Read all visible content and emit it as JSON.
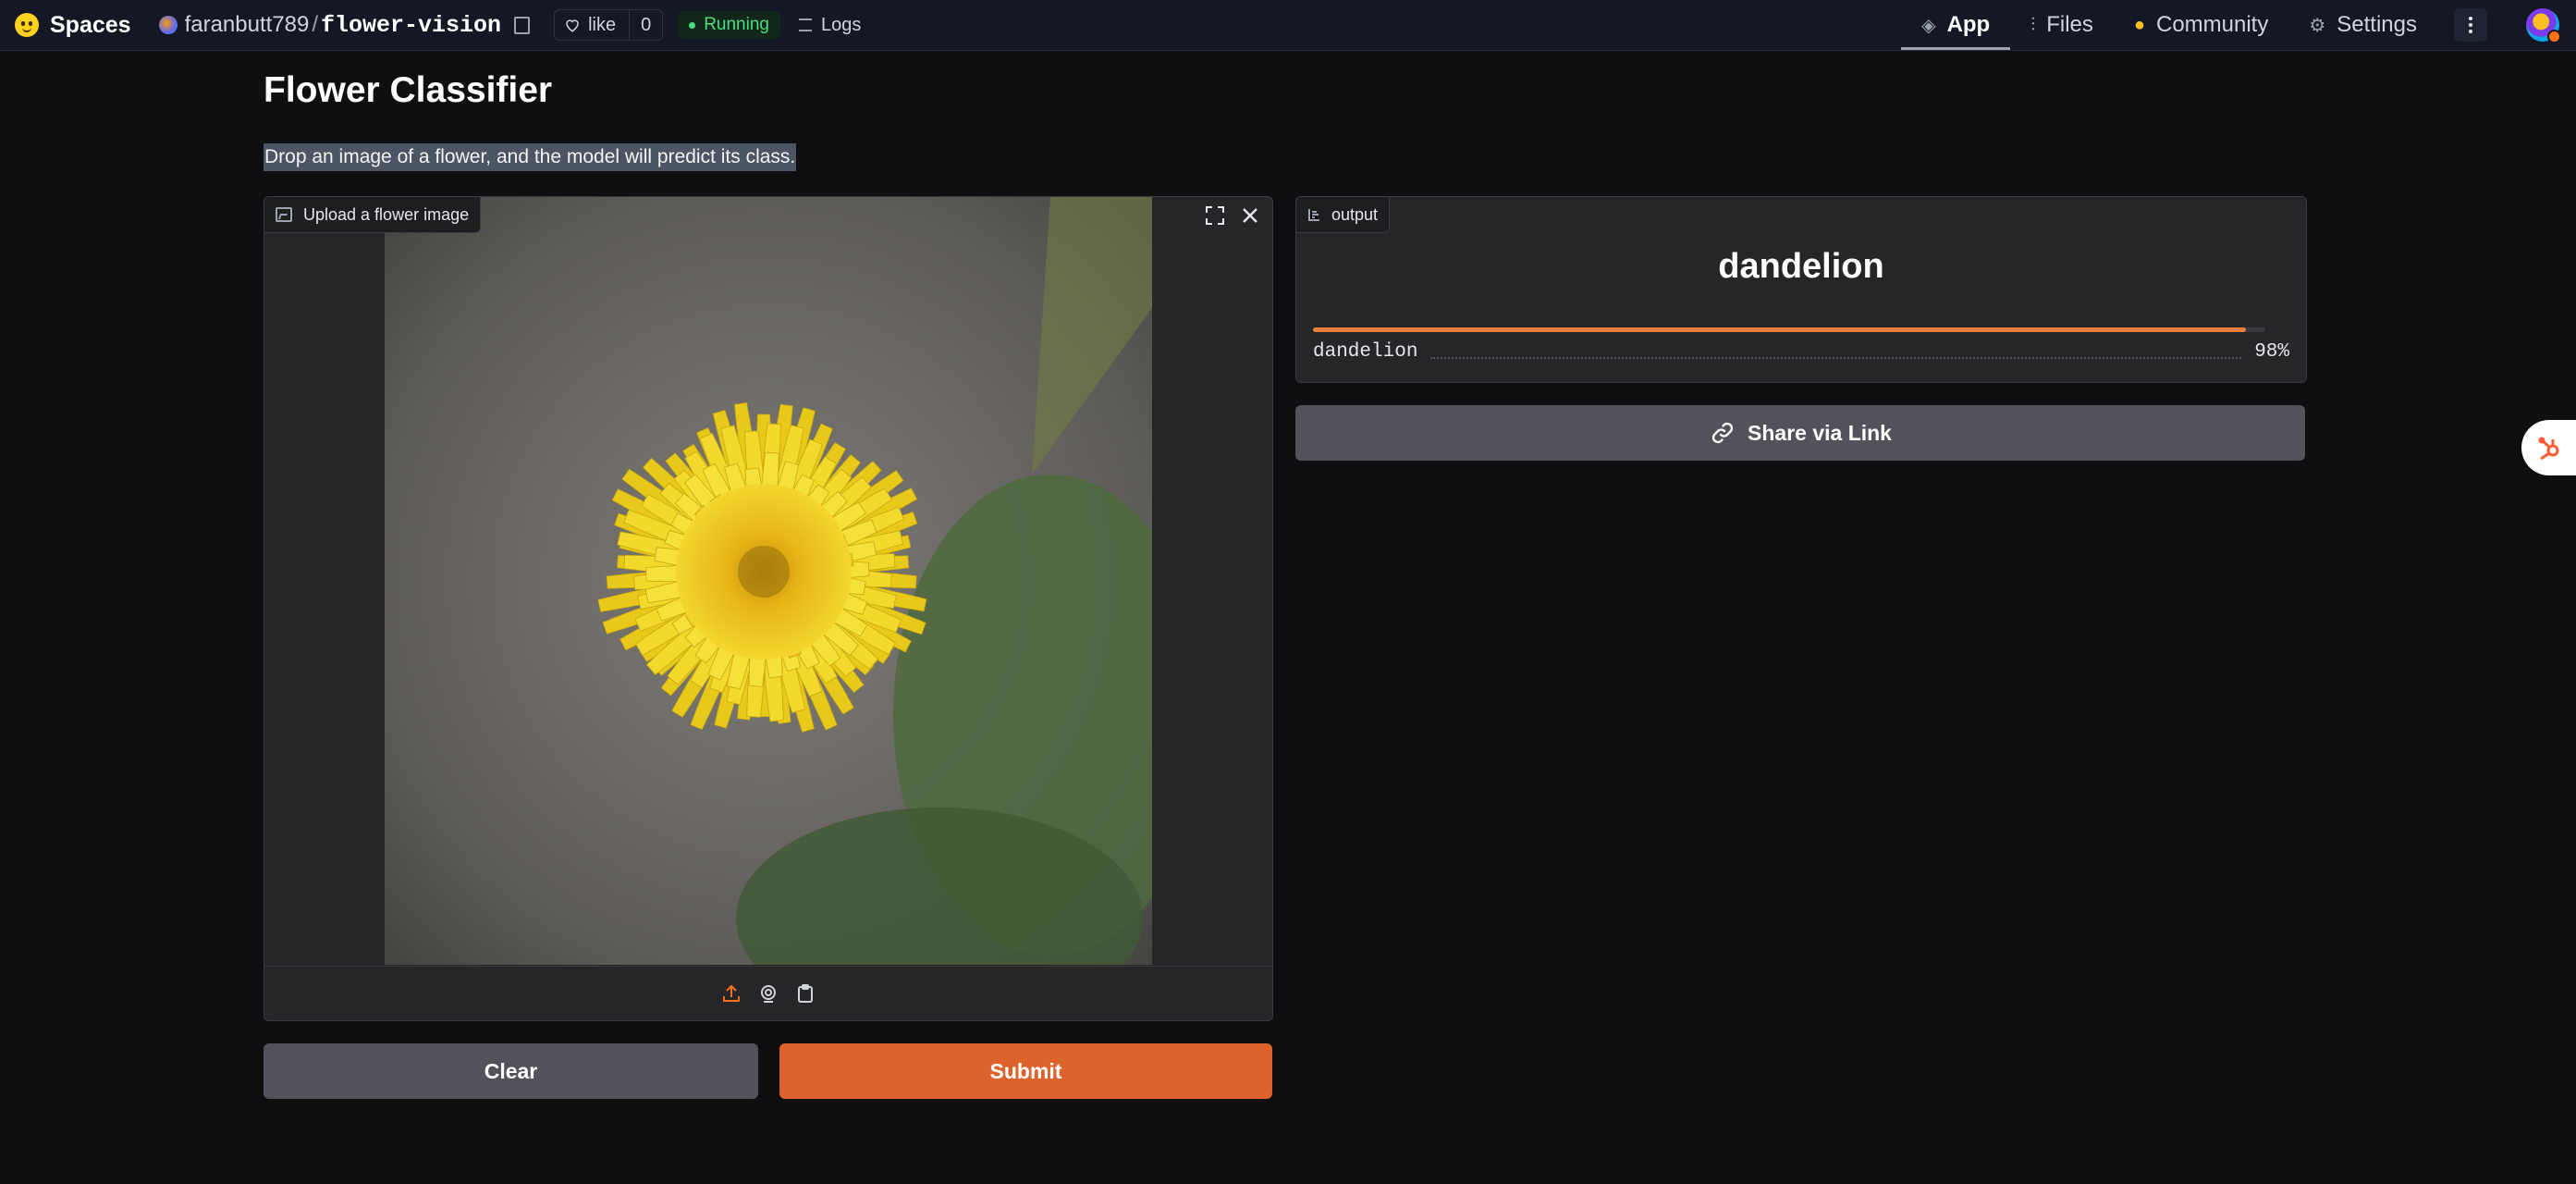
{
  "nav": {
    "brand": "Spaces",
    "owner": "faranbutt789",
    "slash": "/",
    "repo": "flower-vision",
    "like_label": "like",
    "like_count": "0",
    "status": "Running",
    "logs": "Logs",
    "tabs": [
      {
        "label": "App",
        "icon": "cube-icon"
      },
      {
        "label": "Files",
        "icon": "files-icon"
      },
      {
        "label": "Community",
        "icon": "community-icon"
      },
      {
        "label": "Settings",
        "icon": "gear-icon"
      }
    ]
  },
  "app": {
    "title": "Flower Classifier",
    "description": "Drop an image of a flower, and the model will predict its class."
  },
  "input": {
    "label": "Upload a flower image",
    "image_subject": "yellow dandelion flower"
  },
  "output": {
    "label": "output",
    "predicted": "dandelion",
    "confidences": [
      {
        "label": "dandelion",
        "percent": "98%",
        "value": 0.98
      }
    ]
  },
  "buttons": {
    "clear": "Clear",
    "submit": "Submit",
    "share": "Share via Link"
  },
  "colors": {
    "accent": "#dd622b",
    "running": "#4ade80",
    "background": "#0f0f12"
  }
}
